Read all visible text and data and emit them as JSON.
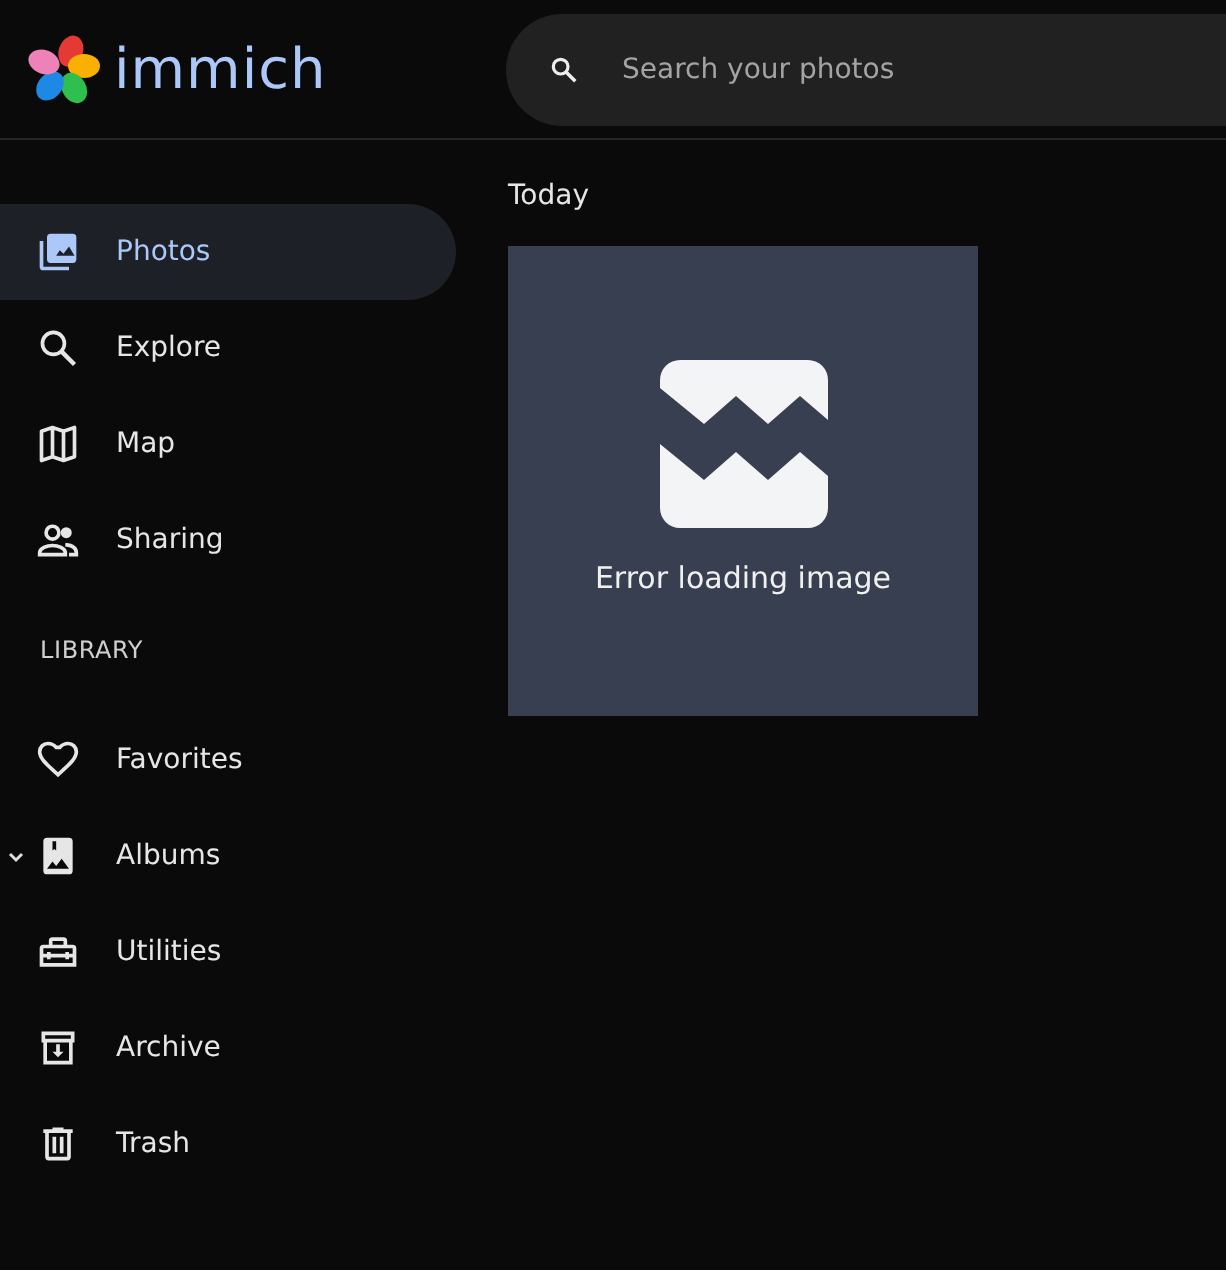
{
  "header": {
    "logo_text": "immich",
    "search": {
      "placeholder": "Search your photos"
    }
  },
  "sidebar": {
    "items": [
      {
        "label": "Photos",
        "selected": true
      },
      {
        "label": "Explore",
        "selected": false
      },
      {
        "label": "Map",
        "selected": false
      },
      {
        "label": "Sharing",
        "selected": false
      }
    ],
    "section_title": "LIBRARY",
    "library_items": [
      {
        "label": "Favorites",
        "selected": false
      },
      {
        "label": "Albums",
        "selected": false,
        "expanded": false
      },
      {
        "label": "Utilities",
        "selected": false
      },
      {
        "label": "Archive",
        "selected": false
      },
      {
        "label": "Trash",
        "selected": false
      }
    ]
  },
  "timeline": {
    "group_title": "Today",
    "tiles": [
      {
        "error": "Error loading image"
      }
    ]
  }
}
